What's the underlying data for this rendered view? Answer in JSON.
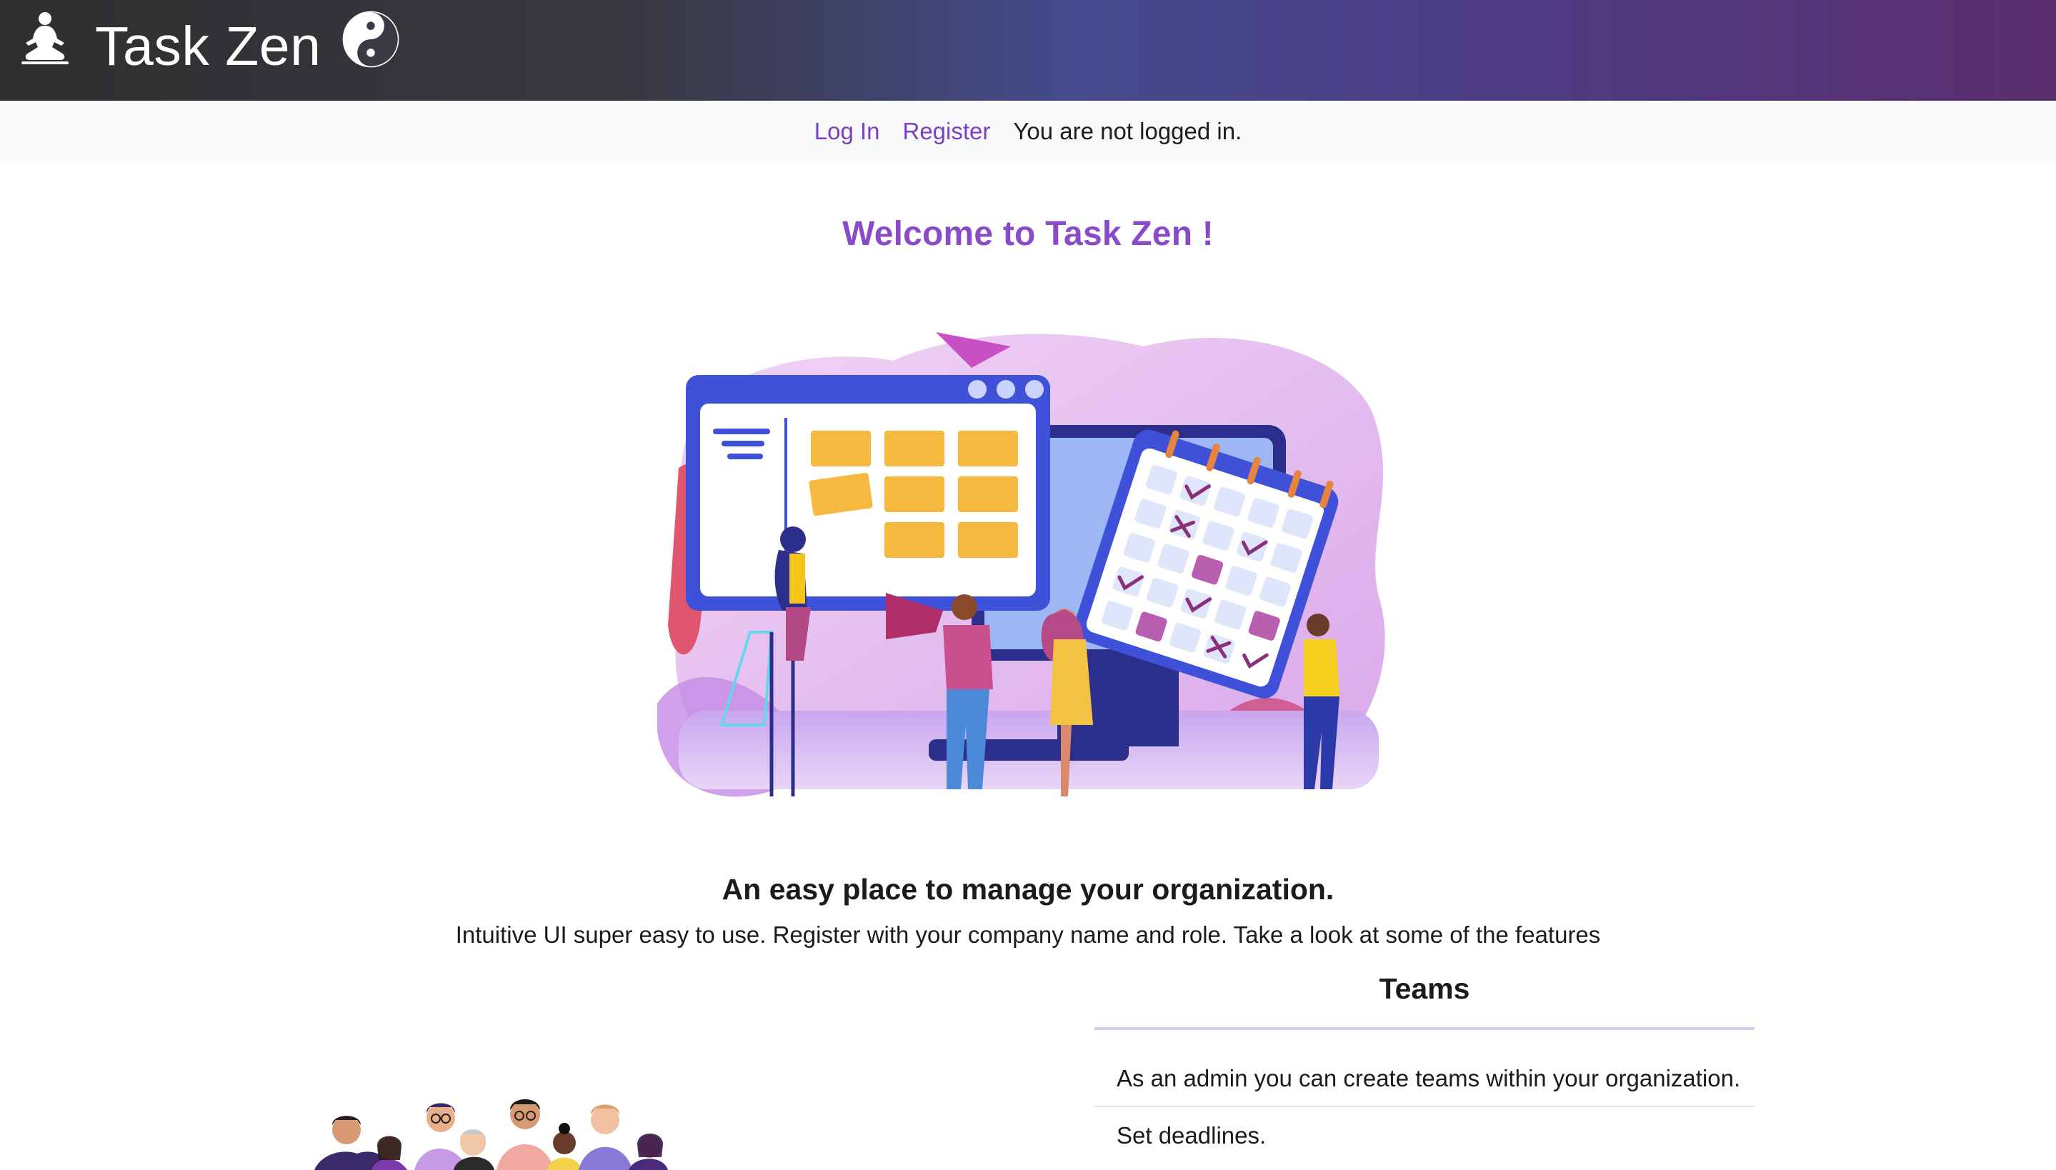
{
  "header": {
    "app_title": "Task Zen",
    "brand_icon": "meditation-icon",
    "side_icon": "yin-yang-icon",
    "colors": {
      "gradient_start": "#2f2f31",
      "gradient_mid": "#454b8c",
      "gradient_end": "#5a2e6e"
    }
  },
  "nav": {
    "login_label": "Log In",
    "register_label": "Register",
    "status_text": "You are not logged in.",
    "link_color": "#7b3fbf"
  },
  "main": {
    "welcome_title": "Welcome to Task Zen !",
    "hero_image": "task-board-illustration",
    "tagline": "An easy place to manage your organization.",
    "subline": "Intuitive UI super easy to use. Register with your company name and role. Take a look at some of the features",
    "accent_color": "#8a4bc9"
  },
  "features": {
    "title": "Teams",
    "items": [
      "As an admin you can create teams within your organization.",
      "Set deadlines."
    ]
  },
  "team_art": "team-people-illustration"
}
